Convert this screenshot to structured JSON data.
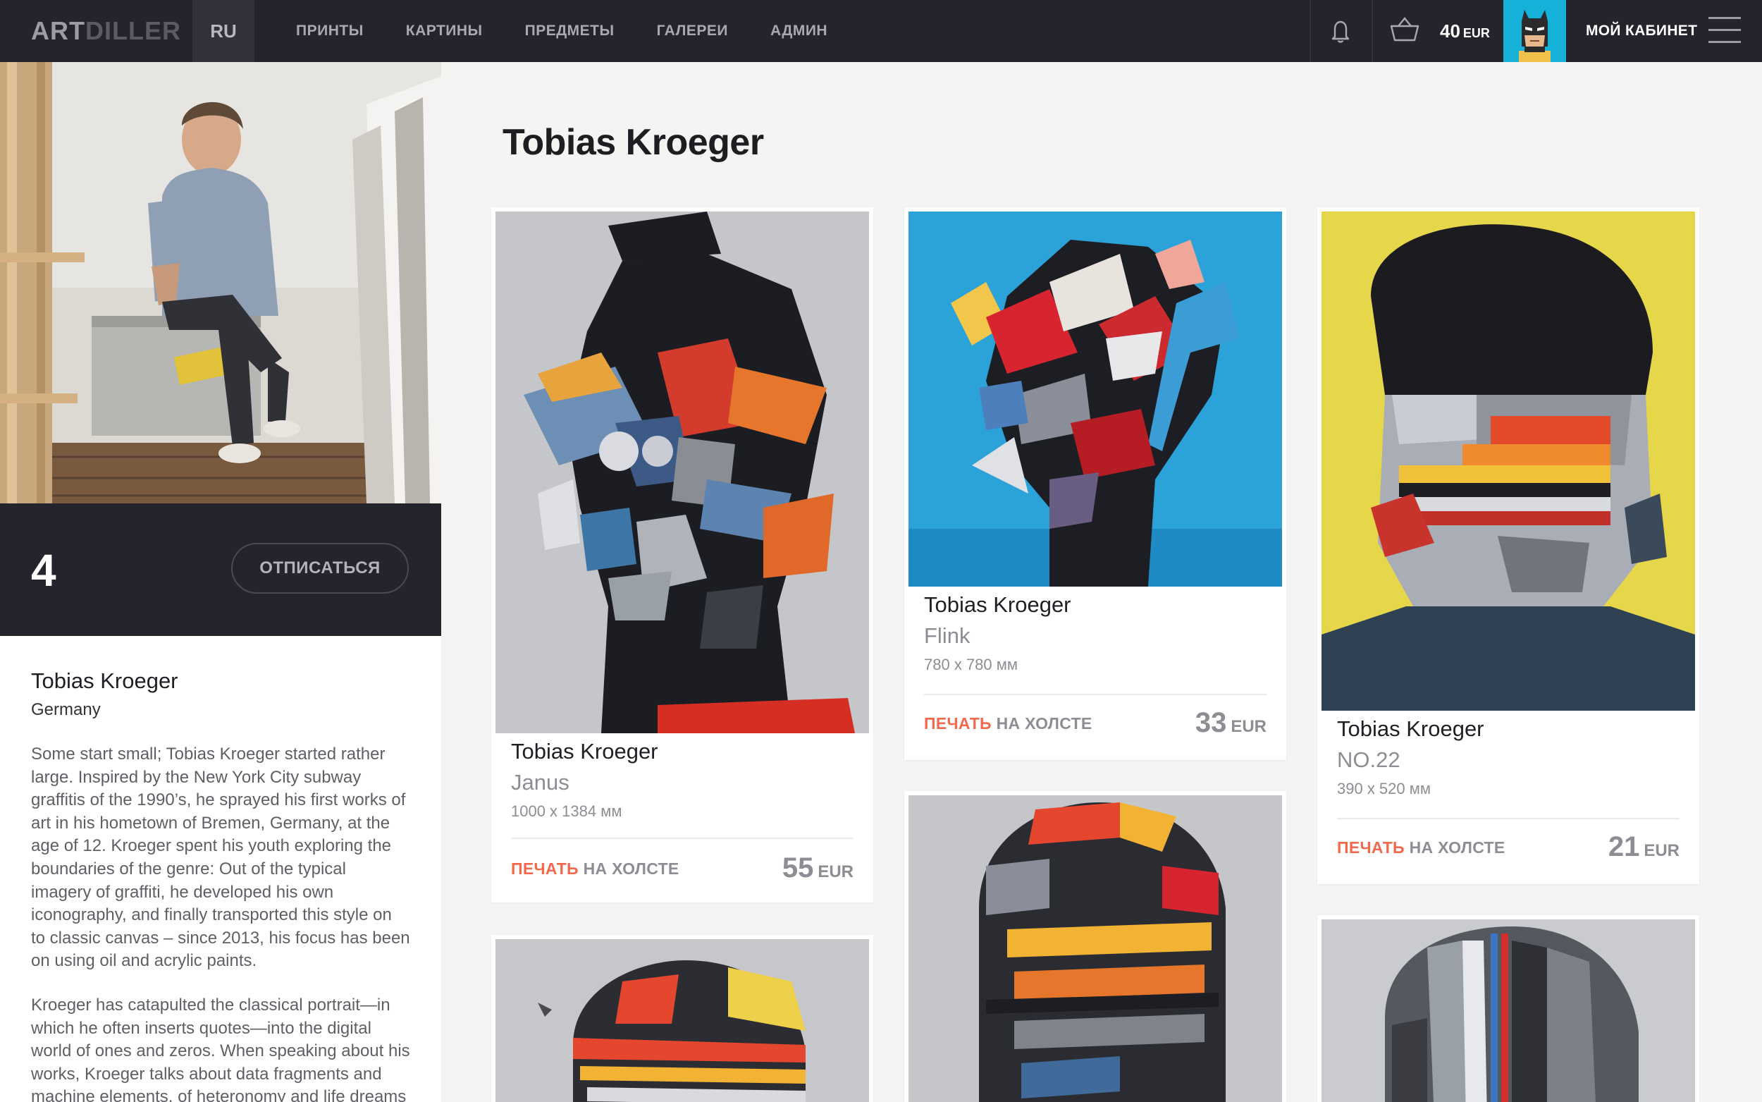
{
  "nav": {
    "logo_part1": "ART",
    "logo_part2": "DILLER",
    "lang": "RU",
    "items": [
      "ПРИНТЫ",
      "КАРТИНЫ",
      "ПРЕДМЕТЫ",
      "ГАЛЕРЕИ",
      "АДМИН"
    ],
    "cart_amount": "40",
    "cart_currency": "EUR",
    "cabinet_label": "МОЙ КАБИНЕТ",
    "icons": [
      "bell-icon",
      "basket-icon",
      "avatar-batman",
      "menu-icon"
    ]
  },
  "artist": {
    "followers": "4",
    "unsubscribe_label": "ОТПИСАТЬСЯ",
    "name": "Tobias Kroeger",
    "country": "Germany",
    "bio_p1": "Some start small; Tobias Kroeger started rather large. Inspired by the New York City subway graffitis of the 1990’s, he sprayed his first works of art in his hometown of Bremen, Germany, at the age of 12. Kroeger spent his youth exploring the boundaries of the genre: Out of the typical imagery of graffiti, he developed his own iconography, and finally transported this style on to classic canvas – since 2013, his focus has been on using oil and acrylic paints.",
    "bio_p2": "Kroeger has catapulted the classical portrait—in which he often inserts quotes—into the digital world of ones and zeros. When speaking about his works, Kroeger talks about data fragments and machine elements, of heteronomy and life dreams that have"
  },
  "page": {
    "title": "Tobias Kroeger"
  },
  "cards": [
    {
      "artist": "Tobias Kroeger",
      "title": "Janus",
      "size": "1000 x 1384 мм",
      "print_hl": "ПЕЧАТЬ",
      "print_rest": " НА ХОЛСТЕ",
      "price": "55",
      "currency": "EUR"
    },
    {
      "artist": "Tobias Kroeger",
      "title": "Flink",
      "size": "780 x 780 мм",
      "print_hl": "ПЕЧАТЬ",
      "print_rest": " НА ХОЛСТЕ",
      "price": "33",
      "currency": "EUR"
    },
    {
      "artist": "Tobias Kroeger",
      "title": "NO.22",
      "size": "390 x 520 мм",
      "print_hl": "ПЕЧАТЬ",
      "print_rest": " НА ХОЛСТЕ",
      "price": "21",
      "currency": "EUR"
    }
  ],
  "colors": {
    "accent": "#f2694e",
    "nav_bg": "#24242c",
    "avatar_bg": "#16b1d8"
  }
}
